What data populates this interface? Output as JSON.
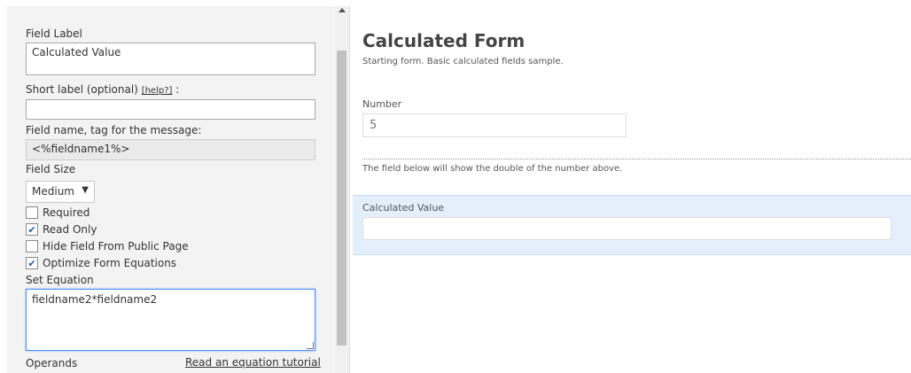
{
  "editor": {
    "field_label": {
      "label": "Field Label",
      "value": "Calculated Value"
    },
    "short_label": {
      "label": "Short label (optional)",
      "help": "[help?]",
      "suffix": ":",
      "value": ""
    },
    "field_name": {
      "label": "Field name, tag for the message:",
      "value": "<%fieldname1%>"
    },
    "field_size": {
      "label": "Field Size",
      "selected": "Medium"
    },
    "checkboxes": [
      {
        "label": "Required",
        "checked": false
      },
      {
        "label": "Read Only",
        "checked": true
      },
      {
        "label": "Hide Field From Public Page",
        "checked": false
      },
      {
        "label": "Optimize Form Equations",
        "checked": true
      }
    ],
    "equation": {
      "label": "Set Equation",
      "value": "fieldname2*fieldname2"
    },
    "operands_label": "Operands",
    "tutorial_link": "Read an equation tutorial"
  },
  "form": {
    "title": "Calculated Form",
    "description": "Starting form. Basic calculated fields sample.",
    "number_field": {
      "label": "Number",
      "value": "5"
    },
    "instruction": "The field below will show the double of the number above.",
    "calculated_field": {
      "label": "Calculated Value",
      "value": ""
    }
  }
}
